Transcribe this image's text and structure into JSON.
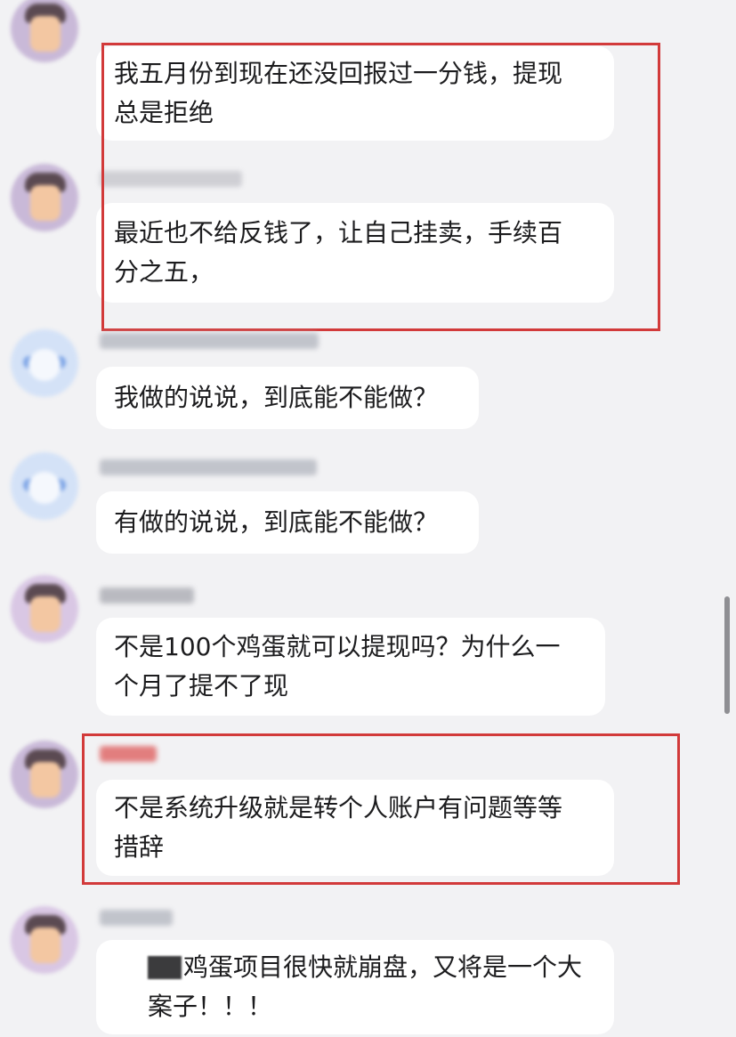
{
  "colors": {
    "background": "#f2f2f4",
    "bubble": "#ffffff",
    "text": "#1c1c1e",
    "highlight_border": "#d23a3a"
  },
  "messages": [
    {
      "avatar": "avatar-purple",
      "text": "我五月份到现在还没回报过一分钱，提现\n总是拒绝"
    },
    {
      "avatar": "avatar-purple",
      "text": "最近也不给反钱了，让自己挂卖，手续百\n分之五，"
    },
    {
      "avatar": "avatar-blue",
      "text": "我做的说说，到底能不能做？"
    },
    {
      "avatar": "avatar-blue",
      "text": "有做的说说，到底能不能做？"
    },
    {
      "avatar": "avatar-purple",
      "text": "不是100个鸡蛋就可以提现吗？为什么一\n个月了提不了现"
    },
    {
      "avatar": "avatar-purple",
      "text": "不是系统升级就是转个人账户有问题等等\n措辞"
    },
    {
      "avatar": "avatar-purple",
      "text": "鸡蛋项目很快就崩盘，又将是一个大\n案子！！！"
    }
  ]
}
